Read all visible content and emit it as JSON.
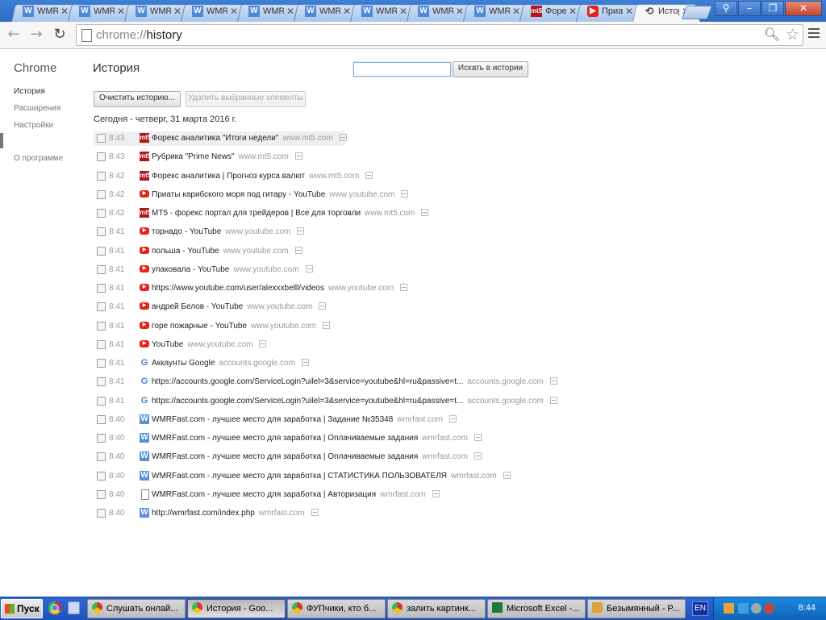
{
  "tabs": [
    {
      "icon": "w-favicon",
      "title": "WMRFast",
      "active": false
    },
    {
      "icon": "w-favicon",
      "title": "WMRFast",
      "active": false
    },
    {
      "icon": "w-favicon",
      "title": "WMRFast",
      "active": false
    },
    {
      "icon": "w-favicon",
      "title": "WMRFast",
      "active": false
    },
    {
      "icon": "w-favicon",
      "title": "WMRFast",
      "active": false
    },
    {
      "icon": "w-favicon",
      "title": "WMRFast",
      "active": false
    },
    {
      "icon": "w-favicon",
      "title": "WMRFast",
      "active": false
    },
    {
      "icon": "w-favicon",
      "title": "WMRFast",
      "active": false
    },
    {
      "icon": "w-favicon",
      "title": "WMRFast",
      "active": false
    },
    {
      "icon": "mt5-favicon",
      "title": "Форекс",
      "active": false
    },
    {
      "icon": "youtube-favicon",
      "title": "Приаты",
      "active": false
    },
    {
      "icon": "history-icon",
      "title": "История",
      "active": true
    }
  ],
  "omnibox": {
    "scheme": "chrome://",
    "path": "history"
  },
  "sidebar": {
    "title": "Chrome",
    "items": [
      "История",
      "Расширения",
      "Настройки"
    ],
    "about": "О программе"
  },
  "main": {
    "title": "История",
    "search_placeholder": "",
    "search_button": "Искать в истории",
    "clear_button": "Очистить историю...",
    "remove_button": "Удалить выбранные элементы",
    "day_header": "Сегодня - четверг, 31 марта 2016 г."
  },
  "entries": [
    {
      "time": "8:43",
      "icon": "mt5",
      "title": "Форекс аналитика \"Итоги недели\"",
      "domain": "www.mt5.com"
    },
    {
      "time": "8:43",
      "icon": "mt5",
      "title": "Рубрика \"Prime News\"",
      "domain": "www.mt5.com"
    },
    {
      "time": "8:42",
      "icon": "mt5",
      "title": "Форекс аналитика | Прогноз курса валют",
      "domain": "www.mt5.com"
    },
    {
      "time": "8:42",
      "icon": "youtube",
      "title": "Приаты карибского моря под гитару - YouTube",
      "domain": "www.youtube.com"
    },
    {
      "time": "8:42",
      "icon": "mt5",
      "title": "МТ5 - форекс портал для трейдеров | Все для торговли",
      "domain": "www.mt5.com"
    },
    {
      "time": "8:41",
      "icon": "youtube",
      "title": "торнадо - YouTube",
      "domain": "www.youtube.com"
    },
    {
      "time": "8:41",
      "icon": "youtube",
      "title": "польша - YouTube",
      "domain": "www.youtube.com"
    },
    {
      "time": "8:41",
      "icon": "youtube",
      "title": "упаковала - YouTube",
      "domain": "www.youtube.com"
    },
    {
      "time": "8:41",
      "icon": "youtube",
      "title": "https://www.youtube.com/user/alexxxbelll/videos",
      "domain": "www.youtube.com"
    },
    {
      "time": "8:41",
      "icon": "youtube",
      "title": "андрей Белов - YouTube",
      "domain": "www.youtube.com"
    },
    {
      "time": "8:41",
      "icon": "youtube",
      "title": "горе пожарные - YouTube",
      "domain": "www.youtube.com"
    },
    {
      "time": "8:41",
      "icon": "youtube",
      "title": "YouTube",
      "domain": "www.youtube.com"
    },
    {
      "time": "8:41",
      "icon": "google",
      "title": "Аккаунты Google",
      "domain": "accounts.google.com"
    },
    {
      "time": "8:41",
      "icon": "google",
      "title": "https://accounts.google.com/ServiceLogin?uilel=3&service=youtube&hl=ru&passive=t...",
      "domain": "accounts.google.com"
    },
    {
      "time": "8:41",
      "icon": "google",
      "title": "https://accounts.google.com/ServiceLogin?uilel=3&service=youtube&hl=ru&passive=t...",
      "domain": "accounts.google.com"
    },
    {
      "time": "8:40",
      "icon": "wmr",
      "title": "WMRFast.com - лучшее место для заработка | Задание №35348",
      "domain": "wmrfast.com"
    },
    {
      "time": "8:40",
      "icon": "wmr",
      "title": "WMRFast.com - лучшее место для заработка | Оплачиваемые задания",
      "domain": "wmrfast.com"
    },
    {
      "time": "8:40",
      "icon": "wmr",
      "title": "WMRFast.com - лучшее место для заработка | Оплачиваемые задания",
      "domain": "wmrfast.com"
    },
    {
      "time": "8:40",
      "icon": "wmr",
      "title": "WMRFast.com - лучшее место для заработка | СТАТИСТИКА ПОЛЬЗОВАТЕЛЯ",
      "domain": "wmrfast.com"
    },
    {
      "time": "8:40",
      "icon": "doc",
      "title": "WMRFast.com - лучшее место для заработка | Авторизация",
      "domain": "wmrfast.com"
    },
    {
      "time": "8:40",
      "icon": "wmr",
      "title": "http://wmrfast.com/index.php",
      "domain": "wmrfast.com"
    }
  ],
  "taskbar": {
    "start": "Пуск",
    "buttons": [
      {
        "icon": "chrome",
        "label": "Слушать онлай...",
        "active": false
      },
      {
        "icon": "chrome",
        "label": "История - Goo...",
        "active": true
      },
      {
        "icon": "chrome",
        "label": "ФУПчики, кто б...",
        "active": false
      },
      {
        "icon": "chrome",
        "label": "залить картинк...",
        "active": false
      },
      {
        "icon": "excel",
        "label": "Microsoft Excel -...",
        "active": false
      },
      {
        "icon": "paint",
        "label": "Безымянный - P...",
        "active": false
      }
    ],
    "language": "EN",
    "clock": "8:44"
  }
}
